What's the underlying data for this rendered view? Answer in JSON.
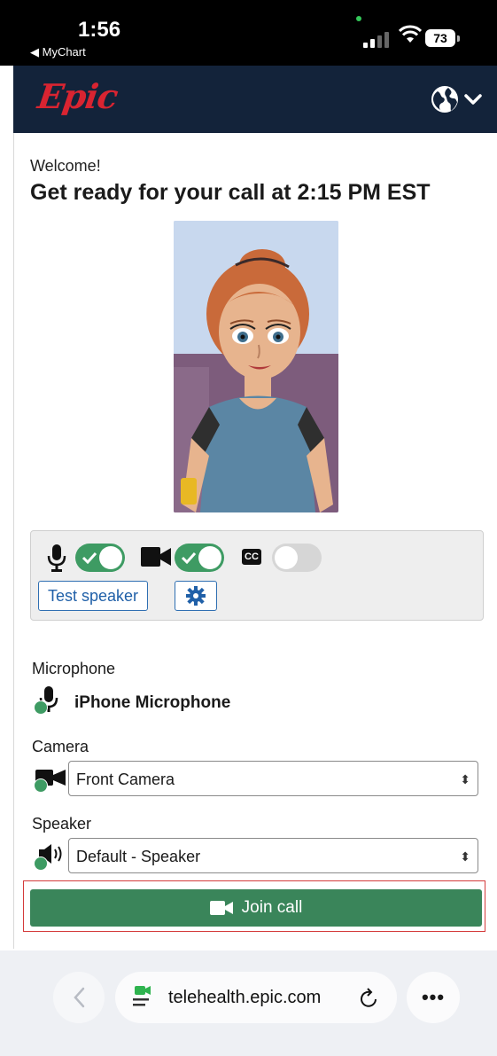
{
  "status_bar": {
    "time": "1:56",
    "back_app": "◀ MyChart",
    "battery": "73"
  },
  "header": {
    "logo_text": "Epic",
    "globe_icon": "globe-icon",
    "menu_icon": "chevron-down-icon",
    "colors": {
      "header_bg": "#13233a",
      "logo": "#d92431"
    }
  },
  "main": {
    "welcome": "Welcome!",
    "title": "Get ready for your call at 2:15 PM EST"
  },
  "controls": {
    "mic_enabled": true,
    "camera_enabled": true,
    "captions_enabled": false,
    "captions_badge": "CC",
    "test_speaker_label": "Test speaker",
    "settings_icon": "gear-icon",
    "toggle_on_color": "#3e9b63"
  },
  "devices": {
    "microphone_label": "Microphone",
    "microphone_value": "iPhone Microphone",
    "camera_label": "Camera",
    "camera_value": "Front Camera",
    "speaker_label": "Speaker",
    "speaker_value": "Default - Speaker"
  },
  "join": {
    "label": "Join call",
    "color": "#3a855a"
  },
  "browser": {
    "url": "telehealth.epic.com",
    "more_label": "•••"
  }
}
